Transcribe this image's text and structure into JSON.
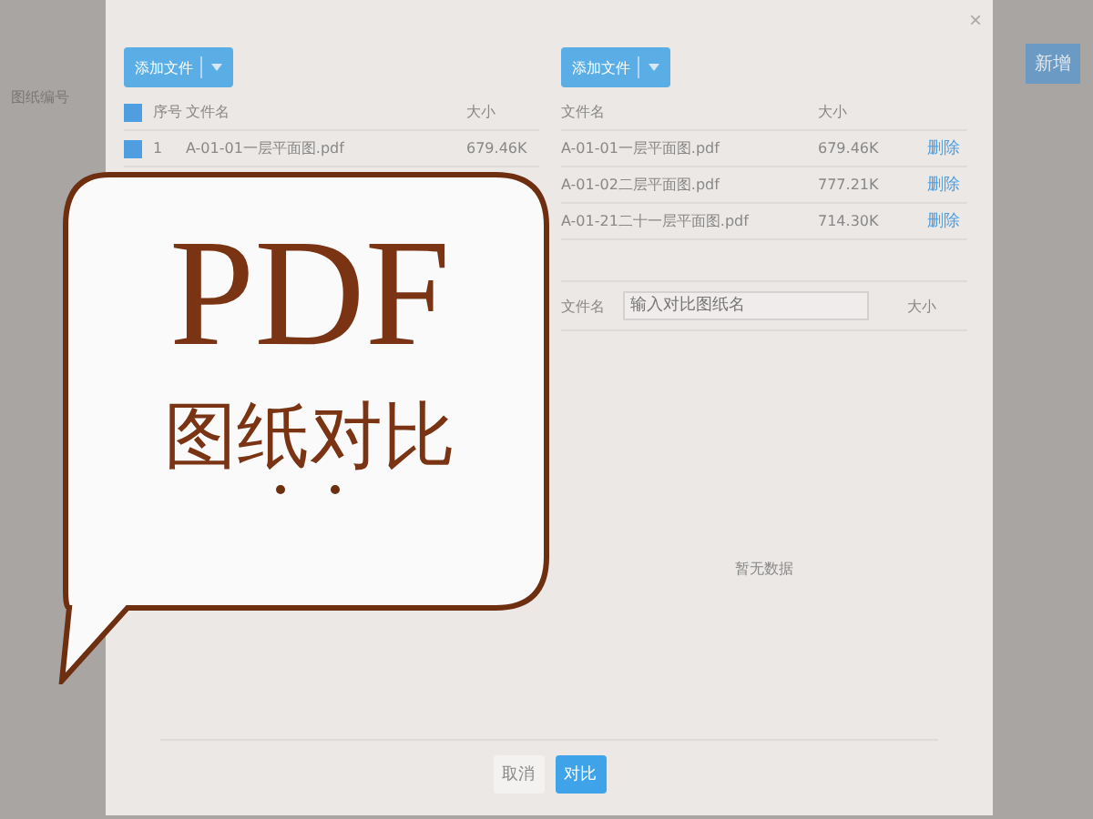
{
  "page_label": "图纸编号",
  "top_button": "新增",
  "dialog": {
    "close": "×",
    "upload_panels": [
      {
        "add_button": "添加文件",
        "header_checked": true,
        "columns": [
          "序号",
          "文件名",
          "大小"
        ],
        "rows": [
          {
            "checked": true,
            "index": "1",
            "name": "A-01-01一层平面图.pdf",
            "size": "679.46K"
          }
        ]
      },
      {
        "add_button": "添加文件",
        "columns": [
          "文件名",
          "大小"
        ],
        "rows": [
          {
            "name": "A-01-01一层平面图.pdf",
            "size": "679.46K",
            "action": "删除"
          },
          {
            "name": "A-01-02二层平面图.pdf",
            "size": "777.21K",
            "action": "删除"
          },
          {
            "name": "A-01-21二十一层平面图.pdf",
            "size": "714.30K",
            "action": "删除"
          }
        ]
      }
    ],
    "result_right": {
      "search_label": "文件名",
      "placeholder": "输入对比图纸名",
      "column": "大小",
      "empty": "暂无数据"
    },
    "footer_buttons": [
      {
        "label": "取消",
        "kind": "default"
      },
      {
        "label": "对比",
        "kind": "primary"
      }
    ]
  },
  "overlay": {
    "title": "PDF",
    "subtitle": "图纸对比"
  }
}
